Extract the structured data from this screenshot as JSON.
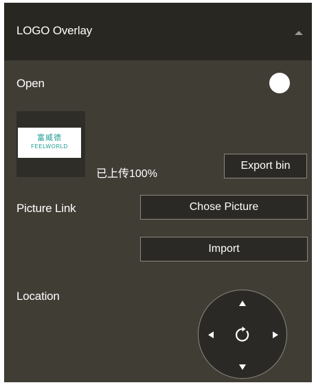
{
  "header": {
    "title": "LOGO Overlay",
    "collapse_icon": "chevron-up-icon"
  },
  "open": {
    "label": "Open",
    "toggle_state": "on"
  },
  "logo_preview": {
    "chinese_text": "富威德",
    "english_text": "FEELWORLD"
  },
  "upload_status": "已上传100%",
  "export_button": "Export bin",
  "picture_link": {
    "label": "Picture Link",
    "chose_button": "Chose Picture",
    "import_button": "Import"
  },
  "location": {
    "label": "Location",
    "controls": [
      "up-arrow-icon",
      "left-arrow-icon",
      "reset-icon",
      "right-arrow-icon",
      "down-arrow-icon"
    ]
  },
  "colors": {
    "panel_bg": "#403d35",
    "header_bg": "#292722",
    "button_bg": "#2b2925",
    "button_border": "#8b8880",
    "logo_text": "#1a9a91"
  }
}
